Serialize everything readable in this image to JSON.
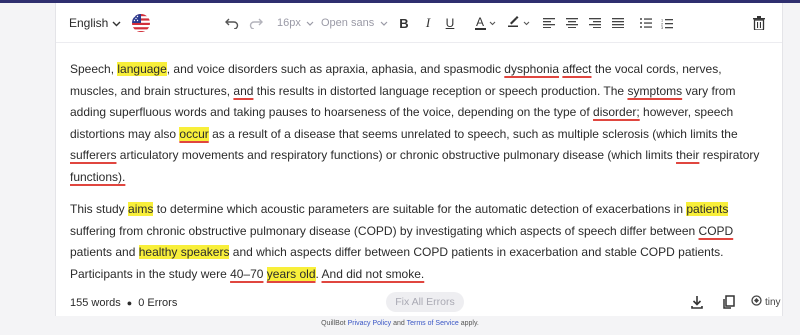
{
  "toolbar": {
    "language": "English",
    "font_size": "16px",
    "font_family": "Open sans",
    "bold_label": "B",
    "italic_label": "I",
    "underline_label": "U",
    "font_color_label": "A"
  },
  "content": {
    "paragraphs": [
      [
        {
          "t": "Speech, "
        },
        {
          "t": "language",
          "hl": true
        },
        {
          "t": ", and voice disorders such as apraxia, aphasia, and spasmodic "
        },
        {
          "t": "dysphonia",
          "ul": true
        },
        {
          "t": " "
        },
        {
          "t": "affect",
          "ul": true
        },
        {
          "t": " the vocal cords, nerves, muscles, and brain structures, "
        },
        {
          "t": "and",
          "ul": true
        },
        {
          "t": " this results in distorted language reception or speech production. The "
        },
        {
          "t": "symptoms",
          "ul": true
        },
        {
          "t": " vary from adding superfluous words and taking pauses to hoarseness of the voice, depending on the type of "
        },
        {
          "t": "disorder;",
          "ul": true
        },
        {
          "t": " however, speech distortions may also "
        },
        {
          "t": "occur",
          "hl": true,
          "ul": true
        },
        {
          "t": " as a result of a disease that seems unrelated to speech, such as multiple sclerosis (which limits the "
        },
        {
          "t": "sufferers",
          "ul": true
        },
        {
          "t": " articulatory movements and respiratory functions) or chronic obstructive pulmonary disease (which limits "
        },
        {
          "t": "their",
          "ul": true
        },
        {
          "t": " respiratory "
        },
        {
          "t": "functions).",
          "ul": true
        }
      ],
      [
        {
          "t": "This study "
        },
        {
          "t": "aims",
          "hl": true
        },
        {
          "t": " to determine which acoustic parameters are suitable for the automatic detection of exacerbations in "
        },
        {
          "t": "patients",
          "hl": true
        },
        {
          "t": " suffering from chronic obstructive pulmonary disease (COPD) by investigating which aspects of speech differ between "
        },
        {
          "t": "COPD",
          "ul": true
        },
        {
          "t": " patients and "
        },
        {
          "t": "healthy speakers",
          "hl": true
        },
        {
          "t": " and which aspects differ between COPD patients in exacerbation and stable COPD patients. Participants in the study were "
        },
        {
          "t": "40–70",
          "ul": true
        },
        {
          "t": " "
        },
        {
          "t": "years old",
          "hl": true,
          "ul": true
        },
        {
          "t": ". "
        },
        {
          "t": "And did not smoke.",
          "ul": true
        }
      ]
    ]
  },
  "footer": {
    "word_count": "155 words",
    "errors": "0 Errors",
    "fix_all_label": "Fix All Errors",
    "tiny_label": "tiny"
  },
  "legal": {
    "prefix": "QuillBot",
    "privacy": "Privacy Policy",
    "and": "and",
    "terms": "Terms of Service",
    "suffix": "apply."
  },
  "colors": {
    "highlight": "#f8ef3a",
    "error_underline": "#e0463f",
    "link": "#3a56c5"
  },
  "icons": [
    "chevron-down-icon",
    "us-flag-icon",
    "undo-icon",
    "redo-icon",
    "text-color-icon",
    "highlighter-icon",
    "align-left-icon",
    "align-center-icon",
    "align-right-icon",
    "justify-icon",
    "bullet-list-icon",
    "numbered-list-icon",
    "trash-icon",
    "download-icon",
    "copy-icon",
    "tiny-logo-icon"
  ]
}
